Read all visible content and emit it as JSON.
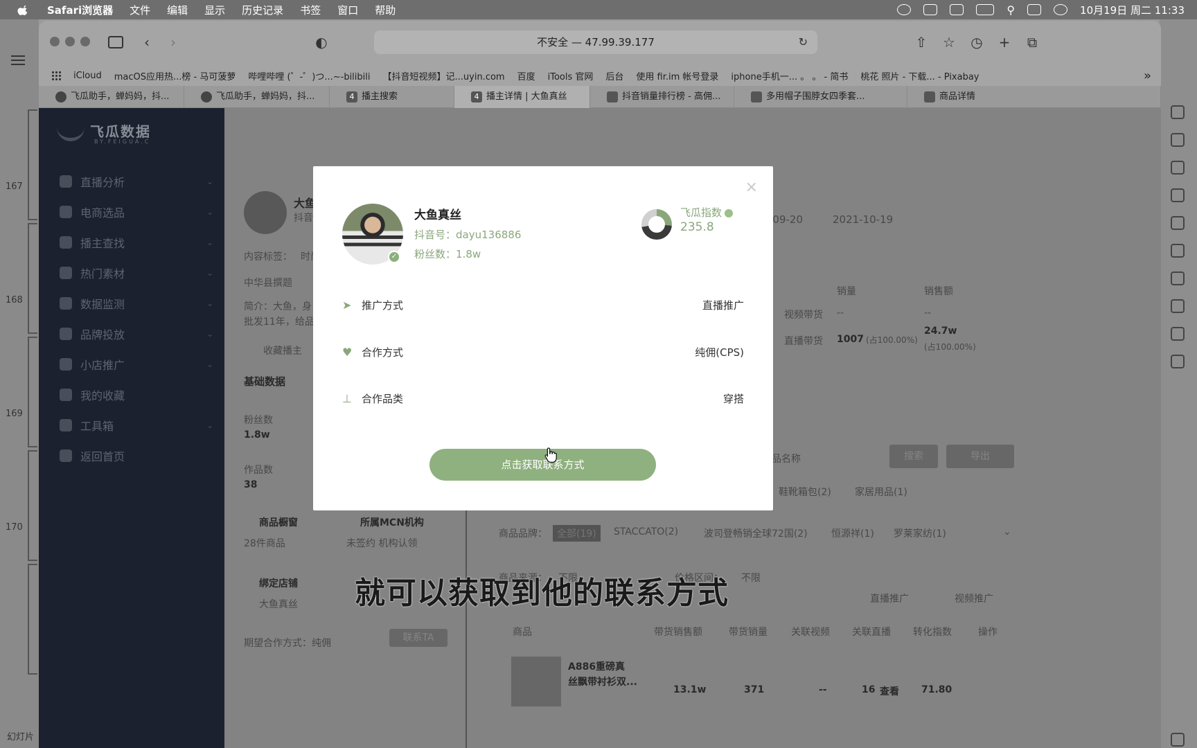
{
  "menubar": {
    "app": "Safari浏览器",
    "items": [
      "文件",
      "编辑",
      "显示",
      "历史记录",
      "书签",
      "窗口",
      "帮助"
    ],
    "datetime": "10月19日 周二  11:33"
  },
  "browser": {
    "url": "不安全 — 47.99.39.177",
    "bookmarks": [
      "iCloud",
      "macOS应用热...榜 - 马可菠萝",
      "哔哩哔哩 (゜-゜)つ...~-bilibili",
      "【抖音短视频】记...uyin.com",
      "百度",
      "iTools 官网",
      "后台",
      "使用 fir.im 帐号登录",
      "iphone手机一... 。 。 - 简书",
      "桃花 照片 - 下载... - Pixabay"
    ],
    "tabs": [
      {
        "label": "飞瓜助手，蝉妈妈，抖...",
        "icon": "feigua-icon",
        "active": false
      },
      {
        "label": "飞瓜助手，蝉妈妈，抖...",
        "icon": "feigua-icon",
        "active": false
      },
      {
        "label": "播主搜索",
        "icon": "4",
        "active": false
      },
      {
        "label": "播主详情 | 大鱼真丝",
        "icon": "4",
        "active": true
      },
      {
        "label": "抖音销量排行榜 - 高佣...",
        "icon": "feigua-icon",
        "active": false
      },
      {
        "label": "多用帽子围脖女四季套...",
        "icon": "feigua-icon",
        "active": false
      },
      {
        "label": "商品详情",
        "icon": "taobao-icon",
        "active": false
      }
    ]
  },
  "background_app": {
    "slide_numbers": [
      "167",
      "168",
      "169",
      "170"
    ],
    "bottom_label": "幻灯片"
  },
  "sidebar": {
    "logo": "飞瓜数据",
    "logo_sub": "BY.FEIGUA.C",
    "items": [
      "直播分析",
      "电商选品",
      "播主查找",
      "热门素材",
      "数据监测",
      "品牌投放",
      "小店推广",
      "我的收藏",
      "工具箱",
      "返回首页"
    ]
  },
  "content": {
    "name_partial": "大鱼",
    "douyin_partial": "抖音号",
    "tags_label": "内容标签：",
    "tags_value": "时尚",
    "location": "中华县撰题",
    "intro": "简介：大鱼，身",
    "intro2": "批发11年，给品牌",
    "collect": "收藏播主",
    "basic_data": "基础数据",
    "fans_label": "粉丝数",
    "fans_value": "1.8w",
    "works_label": "作品数",
    "works_value": "38",
    "showcase_label": "商品橱窗",
    "showcase_value": "28件商品",
    "mcn_label": "所属MCN机构",
    "mcn_value": "未签约 机构认领",
    "shop_label": "绑定店铺",
    "shop_value": "大鱼真丝",
    "coop_label": "期望合作方式：",
    "coop_value": "纯佣",
    "contact_btn": "联系TA",
    "date_start": "-09-20",
    "date_end": "2021-10-19",
    "sales_header": "销量",
    "amount_header": "销售额",
    "video_goods": "视频带货",
    "video_sales": "--",
    "video_amount": "--",
    "live_goods": "直播带货",
    "live_sales": "1007",
    "live_sales_pct": "(占100.00%)",
    "live_amount": "24.7w",
    "live_amount_pct": "(占100.00%)",
    "search_btn": "搜索",
    "export_btn": "导出",
    "search_placeholder": "品名称",
    "cat1": "鞋靴箱包(2)",
    "cat2": "家居用品(1)",
    "brand_label": "商品品牌：",
    "brand_all": "全部(19)",
    "brand2": "STACCATO(2)",
    "brand3": "波司登畅销全球72国(2)",
    "brand4": "恒源祥(1)",
    "brand5": "罗莱家纺(1)",
    "source_label": "商品来源：",
    "source_value": "不限",
    "price_label": "价格区间：",
    "price_value": "不限",
    "live_promo": "直播推广",
    "video_promo": "视频推广",
    "table_headers": [
      "商品",
      "带货销售额",
      "带货销量",
      "关联视频",
      "关联直播",
      "转化指数",
      "操作"
    ],
    "row1": {
      "name": "A886重磅真",
      "name2": "丝飘带衬衫双...",
      "amount": "13.1w",
      "sales": "371",
      "videos": "--",
      "live": "16",
      "action": "查看",
      "conv": "71.80"
    }
  },
  "modal": {
    "name": "大鱼真丝",
    "douyin_label": "抖音号：",
    "douyin_id": "dayu136886",
    "fans_label": "粉丝数：",
    "fans": "1.8w",
    "index_label": "飞瓜指数",
    "index_value": "235.8",
    "rows": [
      {
        "label": "推广方式",
        "value": "直播推广",
        "icon": "paper-plane-icon"
      },
      {
        "label": "合作方式",
        "value": "纯佣(CPS)",
        "icon": "heart-handshake-icon"
      },
      {
        "label": "合作品类",
        "value": "穿搭",
        "icon": "category-tree-icon"
      }
    ],
    "cta": "点击获取联系方式",
    "accent": "#8fb07f"
  },
  "subtitle": "就可以获取到他的联系方式"
}
